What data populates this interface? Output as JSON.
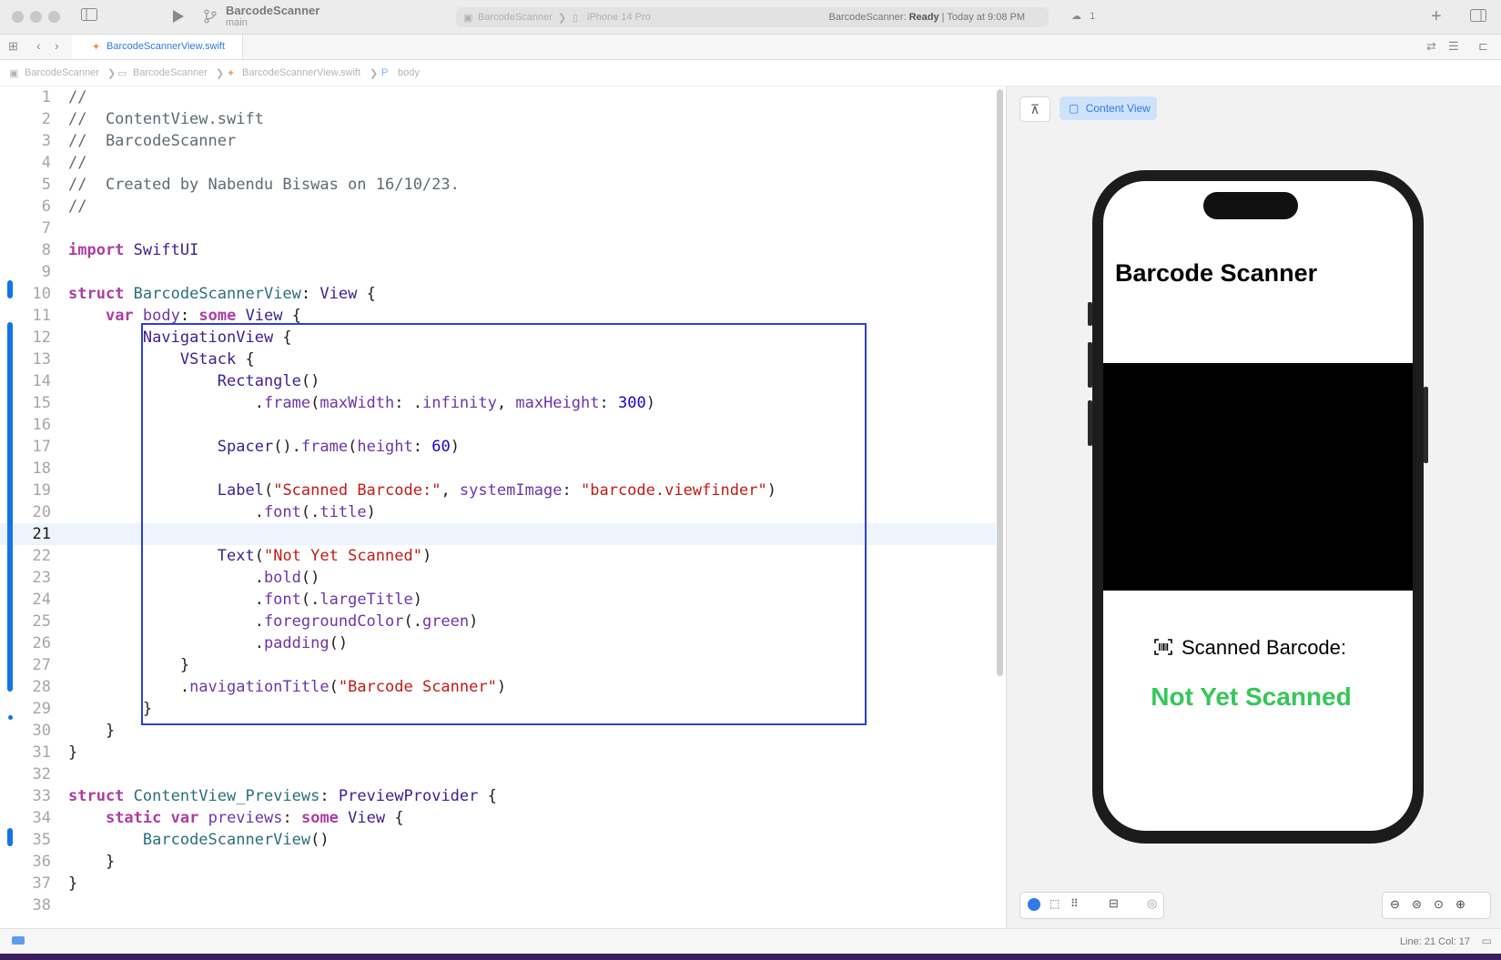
{
  "titlebar": {
    "scheme": "BarcodeScanner",
    "branch": "main",
    "run_scheme": "BarcodeScanner",
    "run_device": "iPhone 14 Pro",
    "status_app": "BarcodeScanner:",
    "status_state": "Ready",
    "status_time": "| Today at 9:08 PM",
    "issue_count": "1"
  },
  "tabbar": {
    "active_tab": "BarcodeScannerView.swift"
  },
  "breadcrumb": {
    "project": "BarcodeScanner",
    "folder": "BarcodeScanner",
    "file": "BarcodeScannerView.swift",
    "symbol": "body"
  },
  "editor": {
    "current_line": 21,
    "lines": [
      "//",
      "//  ContentView.swift",
      "//  BarcodeScanner",
      "//",
      "//  Created by Nabendu Biswas on 16/10/23.",
      "//",
      "",
      "import SwiftUI",
      "",
      "struct BarcodeScannerView: View {",
      "    var body: some View {",
      "        NavigationView {",
      "            VStack {",
      "                Rectangle()",
      "                    .frame(maxWidth: .infinity, maxHeight: 300)",
      "",
      "                Spacer().frame(height: 60)",
      "",
      "                Label(\"Scanned Barcode:\", systemImage: \"barcode.viewfinder\")",
      "                    .font(.title)",
      "",
      "                Text(\"Not Yet Scanned\")",
      "                    .bold()",
      "                    .font(.largeTitle)",
      "                    .foregroundColor(.green)",
      "                    .padding()",
      "            }",
      "            .navigationTitle(\"Barcode Scanner\")",
      "        }",
      "    }",
      "}",
      "",
      "struct ContentView_Previews: PreviewProvider {",
      "    static var previews: some View {",
      "        BarcodeScannerView()",
      "    }",
      "}",
      ""
    ]
  },
  "canvas": {
    "preview_button": "Content View",
    "nav_title": "Barcode Scanner",
    "label_text": "Scanned Barcode:",
    "status_text": "Not Yet Scanned",
    "status_color": "#34c759"
  },
  "bottombar": {
    "position": "Line: 21  Col: 17"
  },
  "colors": {
    "accent": "#2f7ae5",
    "selection_box": "#2a40d9",
    "change_bar": "#1474e8"
  }
}
